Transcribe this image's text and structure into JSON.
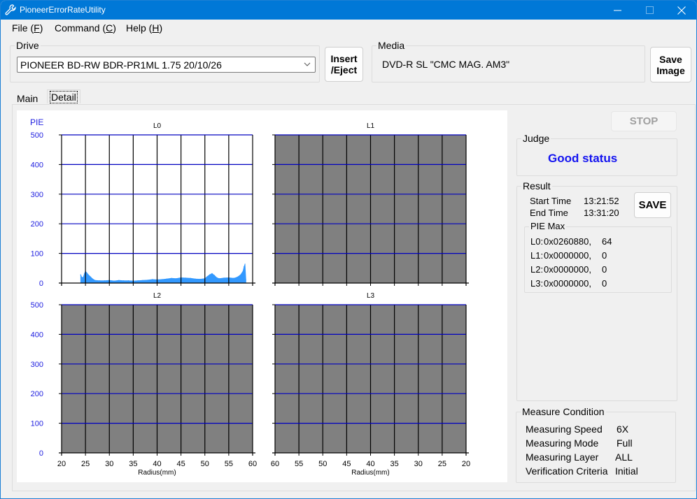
{
  "window": {
    "title": "PioneerErrorRateUtility",
    "icons": {
      "app": "wrench-icon",
      "minimize": "minimize-icon",
      "maximize": "maximize-icon",
      "close": "close-icon"
    }
  },
  "menu": [
    {
      "label": "File (",
      "key": "F",
      "suffix": ")"
    },
    {
      "label": "Command (",
      "key": "C",
      "suffix": ")"
    },
    {
      "label": "Help (",
      "key": "H",
      "suffix": ")"
    }
  ],
  "drive": {
    "group_label": "Drive",
    "selected": "PIONEER BD-RW BDR-PR1ML 1.75 20/10/26",
    "insert_eject_line1": "Insert",
    "insert_eject_line2": "/Eject"
  },
  "media": {
    "group_label": "Media",
    "value": "DVD-R SL \"CMC MAG. AM3\"",
    "save_image_line1": "Save",
    "save_image_line2": "Image"
  },
  "tabs": {
    "main": "Main",
    "detail": "Detail",
    "active": "Detail"
  },
  "controls": {
    "stop": "STOP"
  },
  "judge": {
    "group_label": "Judge",
    "status": "Good status",
    "status_color": "#1414f0"
  },
  "result": {
    "group_label": "Result",
    "start_label": "Start Time",
    "start_value": "13:21:52",
    "end_label": "End Time",
    "end_value": "13:31:20",
    "save_label": "SAVE",
    "pie_max_label": "PIE Max",
    "pie_max": [
      {
        "layer": "L0:",
        "address": "0x0260880,",
        "value": "64"
      },
      {
        "layer": "L1:",
        "address": "0x0000000,",
        "value": "0"
      },
      {
        "layer": "L2:",
        "address": "0x0000000,",
        "value": "0"
      },
      {
        "layer": "L3:",
        "address": "0x0000000,",
        "value": "0"
      }
    ]
  },
  "measure": {
    "group_label": "Measure Condition",
    "rows": [
      {
        "label": "Measuring Speed",
        "value": "6X"
      },
      {
        "label": "Measuring Mode",
        "value": "Full"
      },
      {
        "label": "Measuring Layer",
        "value": "ALL"
      },
      {
        "label": "Verification Criteria",
        "value": "Initial"
      }
    ]
  },
  "chart_data": [
    {
      "type": "area",
      "title": "L0",
      "ylabel": "PIE",
      "xlabel": "",
      "xlim": [
        20,
        60
      ],
      "ylim": [
        0,
        500
      ],
      "x_reversed": false,
      "active": true,
      "xticks": [
        "20",
        "25",
        "30",
        "35",
        "40",
        "45",
        "50",
        "55",
        "60"
      ],
      "yticks": [
        "0",
        "100",
        "200",
        "300",
        "400",
        "500"
      ],
      "color": "#3399ff",
      "x": [
        24.0,
        24.2,
        24.5,
        24.8,
        25.0,
        25.3,
        25.6,
        26.0,
        26.5,
        27.0,
        28,
        29,
        30,
        31,
        32,
        33,
        34,
        35,
        36,
        37,
        38,
        39,
        40,
        41,
        42,
        43,
        44,
        45,
        46,
        47,
        48,
        49,
        50,
        50.5,
        51,
        51.5,
        52,
        52.5,
        53,
        54,
        55,
        56,
        56.5,
        57,
        57.5,
        58,
        58.2,
        58.4,
        58.6
      ],
      "values": [
        28,
        20,
        18,
        32,
        40,
        34,
        28,
        22,
        14,
        9,
        8,
        8,
        9,
        7,
        9,
        8,
        8,
        7,
        8,
        9,
        10,
        12,
        11,
        12,
        14,
        16,
        15,
        18,
        17,
        16,
        14,
        13,
        15,
        22,
        28,
        32,
        26,
        18,
        15,
        17,
        18,
        16,
        18,
        22,
        28,
        40,
        55,
        64,
        10
      ]
    },
    {
      "type": "area",
      "title": "L1",
      "xlim": [
        60,
        20
      ],
      "ylim": [
        0,
        500
      ],
      "x_reversed": true,
      "active": false,
      "xticks": [
        "60",
        "55",
        "50",
        "45",
        "40",
        "35",
        "30",
        "25",
        "20"
      ],
      "x": [],
      "values": []
    },
    {
      "type": "area",
      "title": "L2",
      "ylabel": "",
      "xlabel": "Radius(mm)",
      "xlim": [
        20,
        60
      ],
      "ylim": [
        0,
        500
      ],
      "x_reversed": false,
      "active": false,
      "xticks": [
        "20",
        "25",
        "30",
        "35",
        "40",
        "45",
        "50",
        "55",
        "60"
      ],
      "yticks": [
        "0",
        "100",
        "200",
        "300",
        "400",
        "500"
      ],
      "x": [],
      "values": []
    },
    {
      "type": "area",
      "title": "L3",
      "xlabel": "Radius(mm)",
      "xlim": [
        60,
        20
      ],
      "ylim": [
        0,
        500
      ],
      "x_reversed": true,
      "active": false,
      "xticks": [
        "60",
        "55",
        "50",
        "45",
        "40",
        "35",
        "30",
        "25",
        "20"
      ],
      "x": [],
      "values": []
    }
  ]
}
